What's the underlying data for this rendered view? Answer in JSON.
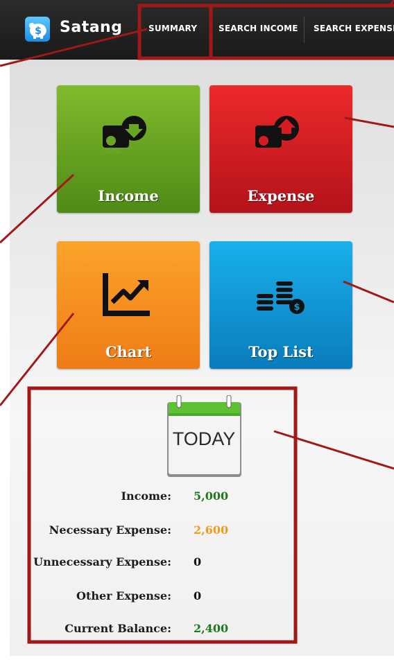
{
  "app": {
    "title": "Satang",
    "logo_icon": "piggy-bank-dollar-icon"
  },
  "nav": {
    "items": [
      {
        "label": "SUMMARY"
      },
      {
        "label": "SEARCH INCOME"
      },
      {
        "label": "SEARCH EXPENSE"
      }
    ]
  },
  "tiles": [
    {
      "label": "Income",
      "icon": "person-arrow-down-icon",
      "color": "#6aa524"
    },
    {
      "label": "Expense",
      "icon": "person-arrow-up-icon",
      "color": "#d51c22"
    },
    {
      "label": "Chart",
      "icon": "line-chart-icon",
      "color": "#f69020"
    },
    {
      "label": "Top List",
      "icon": "coin-stack-dollar-icon",
      "color": "#1498d6"
    }
  ],
  "today": {
    "calendar_text": "TODAY",
    "rows": [
      {
        "label": "Income:",
        "value": "5,000",
        "color": "#1f7a1f"
      },
      {
        "label": "Necessary Expense:",
        "value": "2,600",
        "color": "#f39a1e"
      },
      {
        "label": "Unnecessary Expense:",
        "value": "0",
        "color": "#111111"
      },
      {
        "label": "Other Expense:",
        "value": "0",
        "color": "#111111"
      },
      {
        "label": "Current Balance:",
        "value": "2,400",
        "color": "#1f7a1f"
      }
    ]
  },
  "colors": {
    "topbar": "#222222",
    "annotation": "#a01818"
  }
}
